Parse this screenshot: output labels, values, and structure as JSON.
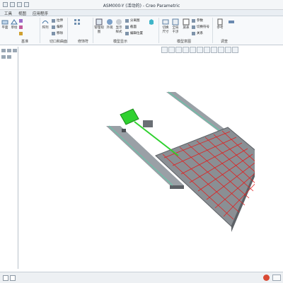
{
  "window": {
    "title": "ASM000-Y (活动的) - Creo Parametric"
  },
  "menu": {
    "items": [
      "工具",
      "视图",
      "应用程序"
    ]
  },
  "ribbon": {
    "groups": [
      "基准",
      "切口和曲面",
      "修饰符",
      "模型显示",
      "模型意图",
      "调查"
    ],
    "buttons": {
      "plane": "平面",
      "sketch": "草绘",
      "pattern": "阵列",
      "manage_views": "管理视图",
      "appearance": "外观",
      "display_style": "显示样式",
      "section": "截面",
      "family_table": "族表",
      "switch_dims": "切换尺寸",
      "relations": "关系",
      "parameters": "参数",
      "global_interference": "全局干涉",
      "reference": "参考",
      "pull": "拉伸",
      "offset": "偏移",
      "remove": "移除",
      "split": "分离图",
      "edit_position": "编辑位置",
      "param": "参数",
      "switch_symbol": "切换符号",
      "relation": "关系"
    }
  },
  "colors": {
    "frame": "#8a8f94",
    "frame_dark": "#5d6166",
    "grid_red": "#e02020",
    "motor_green": "#2fd12f",
    "rail_teal": "#6fbfa8"
  }
}
